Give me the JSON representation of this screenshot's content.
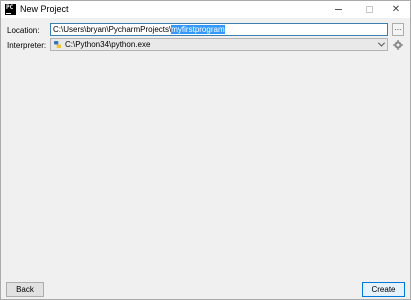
{
  "window": {
    "title": "New Project",
    "app_icon_text": "PC",
    "controls": {
      "minimize": "minimize-icon",
      "maximize": "maximize-icon",
      "close": "close-icon"
    }
  },
  "form": {
    "location_label": "Location:",
    "location_prefix": "C:\\Users\\bryan\\PycharmProjects\\",
    "location_selected": "myfirstprogram",
    "browse_label": "...",
    "interpreter_label": "Interpreter:",
    "interpreter_value": "C:\\Python34\\python.exe"
  },
  "footer": {
    "back_label": "Back",
    "create_label": "Create"
  },
  "colors": {
    "selection": "#3399ff",
    "focus_border": "#3c7fb1",
    "window_bg": "#f0f0f0"
  }
}
